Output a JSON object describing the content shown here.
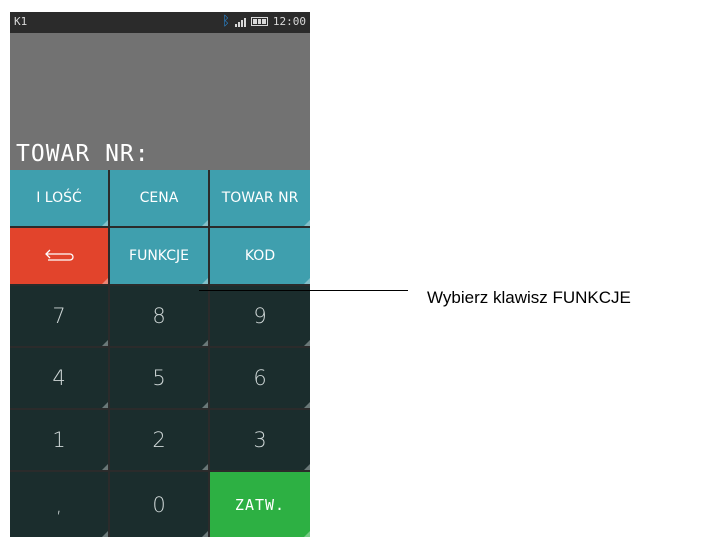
{
  "status": {
    "channel": "K1",
    "time": "12:00",
    "icons": [
      "bluetooth-icon",
      "signal-icon",
      "battery-icon"
    ]
  },
  "display": {
    "prompt": "TOWAR NR:"
  },
  "keys": {
    "ilosc": "I LOŚĆ",
    "cena": "CENA",
    "towar_nr": "TOWAR NR",
    "back": "back-arrow-icon",
    "funkcje": "FUNKCJE",
    "kod": "KOD",
    "k7": "7",
    "k8": "8",
    "k9": "9",
    "k4": "4",
    "k5": "5",
    "k6": "6",
    "k1": "1",
    "k2": "2",
    "k3": "3",
    "comma": ",",
    "k0": "0",
    "zatw": "ZATW."
  },
  "annotation": {
    "text": "Wybierz klawisz FUNKCJE"
  },
  "colors": {
    "teal_key": "#3f9fae",
    "red_key": "#e2442c",
    "dark_key": "#1b2d2d",
    "green_key": "#2db043",
    "display_bg": "#727272"
  }
}
